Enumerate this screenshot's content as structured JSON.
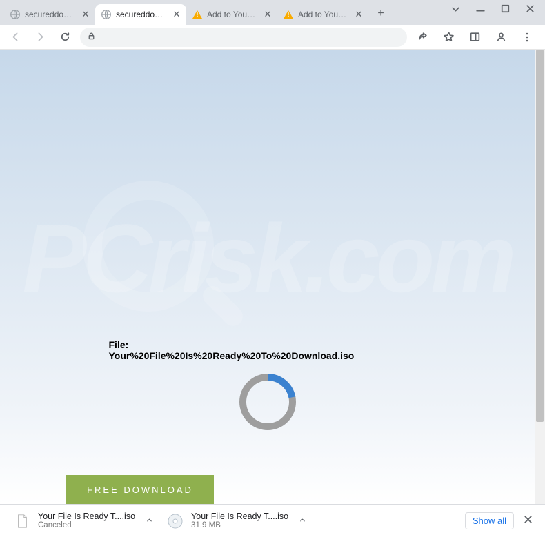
{
  "tabs": [
    {
      "label": "secureddownload",
      "icon": "globe",
      "active": false
    },
    {
      "label": "secureddownload",
      "icon": "globe",
      "active": true
    },
    {
      "label": "Add to Your Brows",
      "icon": "warning",
      "active": false
    },
    {
      "label": "Add to Your Brows",
      "icon": "warning",
      "active": false
    }
  ],
  "page": {
    "file_label": "File:",
    "file_name": "Your%20File%20Is%20Ready%20To%20Download.iso",
    "download_button": "FREE DOWNLOAD",
    "spinner_percent": 22
  },
  "downloads": {
    "items": [
      {
        "title": "Your File Is Ready T....iso",
        "subtitle": "Canceled",
        "icon": "blank"
      },
      {
        "title": "Your File Is Ready T....iso",
        "subtitle": "31.9 MB",
        "icon": "disc"
      }
    ],
    "show_all": "Show all"
  },
  "watermark": "PCrisk.com"
}
